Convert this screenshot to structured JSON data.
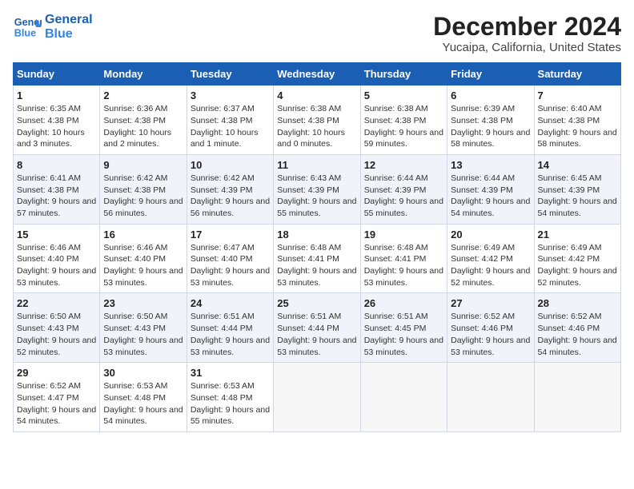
{
  "logo": {
    "line1": "General",
    "line2": "Blue"
  },
  "title": "December 2024",
  "location": "Yucaipa, California, United States",
  "days_of_week": [
    "Sunday",
    "Monday",
    "Tuesday",
    "Wednesday",
    "Thursday",
    "Friday",
    "Saturday"
  ],
  "weeks": [
    [
      {
        "day": 1,
        "sunrise": "6:35 AM",
        "sunset": "4:38 PM",
        "daylight": "10 hours and 3 minutes."
      },
      {
        "day": 2,
        "sunrise": "6:36 AM",
        "sunset": "4:38 PM",
        "daylight": "10 hours and 2 minutes."
      },
      {
        "day": 3,
        "sunrise": "6:37 AM",
        "sunset": "4:38 PM",
        "daylight": "10 hours and 1 minute."
      },
      {
        "day": 4,
        "sunrise": "6:38 AM",
        "sunset": "4:38 PM",
        "daylight": "10 hours and 0 minutes."
      },
      {
        "day": 5,
        "sunrise": "6:38 AM",
        "sunset": "4:38 PM",
        "daylight": "9 hours and 59 minutes."
      },
      {
        "day": 6,
        "sunrise": "6:39 AM",
        "sunset": "4:38 PM",
        "daylight": "9 hours and 58 minutes."
      },
      {
        "day": 7,
        "sunrise": "6:40 AM",
        "sunset": "4:38 PM",
        "daylight": "9 hours and 58 minutes."
      }
    ],
    [
      {
        "day": 8,
        "sunrise": "6:41 AM",
        "sunset": "4:38 PM",
        "daylight": "9 hours and 57 minutes."
      },
      {
        "day": 9,
        "sunrise": "6:42 AM",
        "sunset": "4:38 PM",
        "daylight": "9 hours and 56 minutes."
      },
      {
        "day": 10,
        "sunrise": "6:42 AM",
        "sunset": "4:39 PM",
        "daylight": "9 hours and 56 minutes."
      },
      {
        "day": 11,
        "sunrise": "6:43 AM",
        "sunset": "4:39 PM",
        "daylight": "9 hours and 55 minutes."
      },
      {
        "day": 12,
        "sunrise": "6:44 AM",
        "sunset": "4:39 PM",
        "daylight": "9 hours and 55 minutes."
      },
      {
        "day": 13,
        "sunrise": "6:44 AM",
        "sunset": "4:39 PM",
        "daylight": "9 hours and 54 minutes."
      },
      {
        "day": 14,
        "sunrise": "6:45 AM",
        "sunset": "4:39 PM",
        "daylight": "9 hours and 54 minutes."
      }
    ],
    [
      {
        "day": 15,
        "sunrise": "6:46 AM",
        "sunset": "4:40 PM",
        "daylight": "9 hours and 53 minutes."
      },
      {
        "day": 16,
        "sunrise": "6:46 AM",
        "sunset": "4:40 PM",
        "daylight": "9 hours and 53 minutes."
      },
      {
        "day": 17,
        "sunrise": "6:47 AM",
        "sunset": "4:40 PM",
        "daylight": "9 hours and 53 minutes."
      },
      {
        "day": 18,
        "sunrise": "6:48 AM",
        "sunset": "4:41 PM",
        "daylight": "9 hours and 53 minutes."
      },
      {
        "day": 19,
        "sunrise": "6:48 AM",
        "sunset": "4:41 PM",
        "daylight": "9 hours and 53 minutes."
      },
      {
        "day": 20,
        "sunrise": "6:49 AM",
        "sunset": "4:42 PM",
        "daylight": "9 hours and 52 minutes."
      },
      {
        "day": 21,
        "sunrise": "6:49 AM",
        "sunset": "4:42 PM",
        "daylight": "9 hours and 52 minutes."
      }
    ],
    [
      {
        "day": 22,
        "sunrise": "6:50 AM",
        "sunset": "4:43 PM",
        "daylight": "9 hours and 52 minutes."
      },
      {
        "day": 23,
        "sunrise": "6:50 AM",
        "sunset": "4:43 PM",
        "daylight": "9 hours and 53 minutes."
      },
      {
        "day": 24,
        "sunrise": "6:51 AM",
        "sunset": "4:44 PM",
        "daylight": "9 hours and 53 minutes."
      },
      {
        "day": 25,
        "sunrise": "6:51 AM",
        "sunset": "4:44 PM",
        "daylight": "9 hours and 53 minutes."
      },
      {
        "day": 26,
        "sunrise": "6:51 AM",
        "sunset": "4:45 PM",
        "daylight": "9 hours and 53 minutes."
      },
      {
        "day": 27,
        "sunrise": "6:52 AM",
        "sunset": "4:46 PM",
        "daylight": "9 hours and 53 minutes."
      },
      {
        "day": 28,
        "sunrise": "6:52 AM",
        "sunset": "4:46 PM",
        "daylight": "9 hours and 54 minutes."
      }
    ],
    [
      {
        "day": 29,
        "sunrise": "6:52 AM",
        "sunset": "4:47 PM",
        "daylight": "9 hours and 54 minutes."
      },
      {
        "day": 30,
        "sunrise": "6:53 AM",
        "sunset": "4:48 PM",
        "daylight": "9 hours and 54 minutes."
      },
      {
        "day": 31,
        "sunrise": "6:53 AM",
        "sunset": "4:48 PM",
        "daylight": "9 hours and 55 minutes."
      },
      null,
      null,
      null,
      null
    ]
  ]
}
